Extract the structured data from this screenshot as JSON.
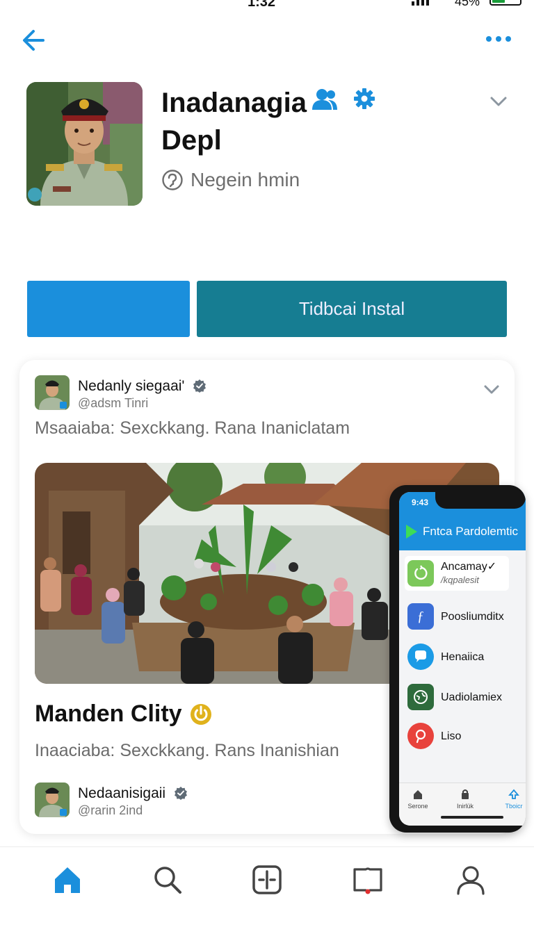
{
  "status_bar": {
    "time": "1:32",
    "battery": "45%"
  },
  "profile": {
    "name_line1": "Inadanagia",
    "name_line2": "Depl",
    "subtitle": "Negein hmin"
  },
  "actions": {
    "primary_label": "",
    "secondary_label": "Tidbcai Instal"
  },
  "post": {
    "author_name": "Nedanly siegaai'",
    "author_handle": "@adsm Tinri",
    "text": "Msaaiaba: Sexckkang. Rana Inaniclatam",
    "title": "Manden Clity",
    "text2": "Inaaciaba: Sexckkang. Rans Inanishian",
    "footer_author_name": "Nedaanisigaii",
    "footer_author_handle": "@rarin 2ind"
  },
  "phone_mockup": {
    "status_time": "9:43",
    "header_title": "Fntca Pardolemtic",
    "apps": [
      {
        "label": "Ancamay✓",
        "sublabel": "/kqpalesit",
        "icon": "refresh-icon",
        "color": "#7cc85a"
      },
      {
        "label": "Poosliumditx",
        "sublabel": "",
        "icon": "font-icon",
        "color": "#3b6ed6"
      },
      {
        "label": "Henaiica",
        "sublabel": "",
        "icon": "chat-icon",
        "color": "#1b9be6"
      },
      {
        "label": "Uadiolamiex",
        "sublabel": "",
        "icon": "globe-icon",
        "color": "#2e6b3c"
      },
      {
        "label": "Liso",
        "sublabel": "",
        "icon": "pin-icon",
        "color": "#e8423c"
      }
    ],
    "tabs": [
      "Serone",
      "Inirlük",
      "Tboicr"
    ]
  },
  "bottom_nav": [
    "home-icon",
    "search-icon",
    "compose-icon",
    "book-icon",
    "profile-icon"
  ],
  "colors": {
    "accent_blue": "#1b8fdc",
    "teal": "#167d92",
    "verified_gray": "#5f6b76",
    "power_yellow": "#e0b21c"
  }
}
